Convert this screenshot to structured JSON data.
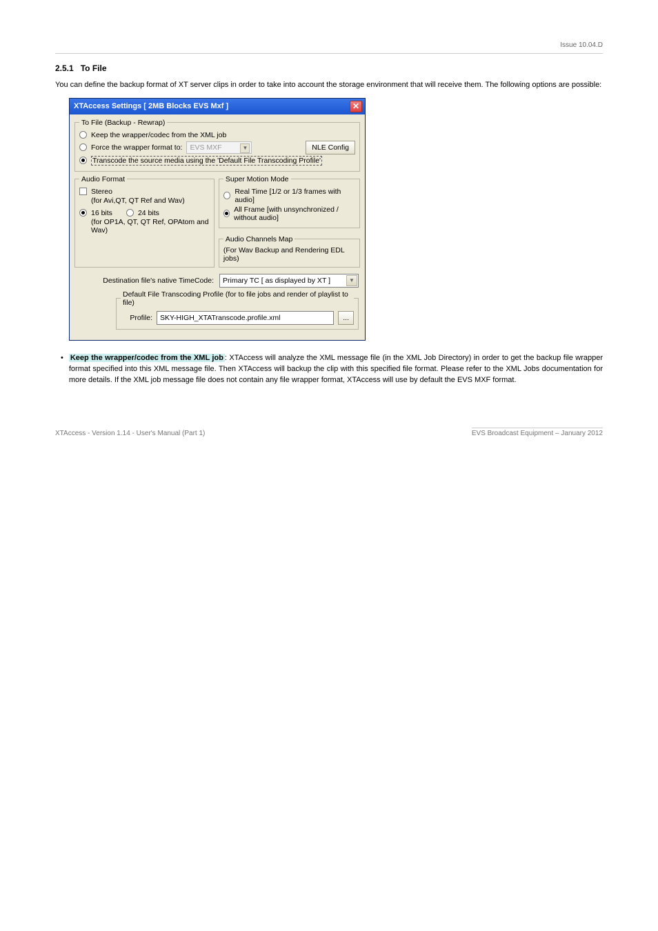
{
  "header": "Issue 10.04.D",
  "section_number": "2.5.1",
  "section_title": "To File",
  "para1": "You can define the backup format of XT server clips in order to take into account the storage environment that will receive them. The following options are possible:",
  "dialog": {
    "title": "XTAccess Settings [ 2MB Blocks EVS Mxf ]",
    "group_tofile": {
      "legend": "To File (Backup - Rewrap)",
      "opt_keep": "Keep the wrapper/codec from the XML job",
      "opt_force": "Force the wrapper format to:",
      "force_combo": "EVS MXF",
      "nle_btn": "NLE Config",
      "opt_transcode": "Transcode the source media using the 'Default File Transcoding Profile'"
    },
    "group_audio": {
      "legend": "Audio Format",
      "stereo": "Stereo",
      "stereo_help": "(for Avi,QT, QT Ref and Wav)",
      "r16": "16 bits",
      "r24": "24 bits",
      "bits_help": "(for OP1A, QT, QT Ref, OPAtom and Wav)"
    },
    "group_sm": {
      "legend": "Super Motion Mode",
      "realtime": "Real Time [1/2 or 1/3 frames with audio]",
      "allframe": "All Frame [with unsynchronized / without audio]"
    },
    "group_chan": {
      "legend": "Audio Channels Map",
      "help": "(For Wav Backup and Rendering EDL jobs)"
    },
    "tc_label": "Destination file's native TimeCode:",
    "tc_value": "Primary TC [ as displayed by XT ]",
    "group_profile": {
      "legend": "Default File Transcoding Profile (for to file jobs and render of playlist to file)",
      "label": "Profile:",
      "value": "SKY-HIGH_XTATranscode.profile.xml",
      "browse": "..."
    }
  },
  "bullet_label": "Keep the wrapper/codec from the XML job",
  "bullet_text": ": XTAccess will analyze the XML message file (in the XML Job Directory) in order to get the backup file wrapper format specified into this XML message file. Then XTAccess will backup the clip with this specified file format. Please refer to the XML Jobs documentation for more details. If the XML job message file does not contain any file wrapper format, XTAccess will use by default the EVS MXF format.",
  "footer": {
    "left": "XTAccess - Version 1.14 - User's Manual (Part 1)",
    "right": "EVS Broadcast Equipment – January 2012"
  }
}
